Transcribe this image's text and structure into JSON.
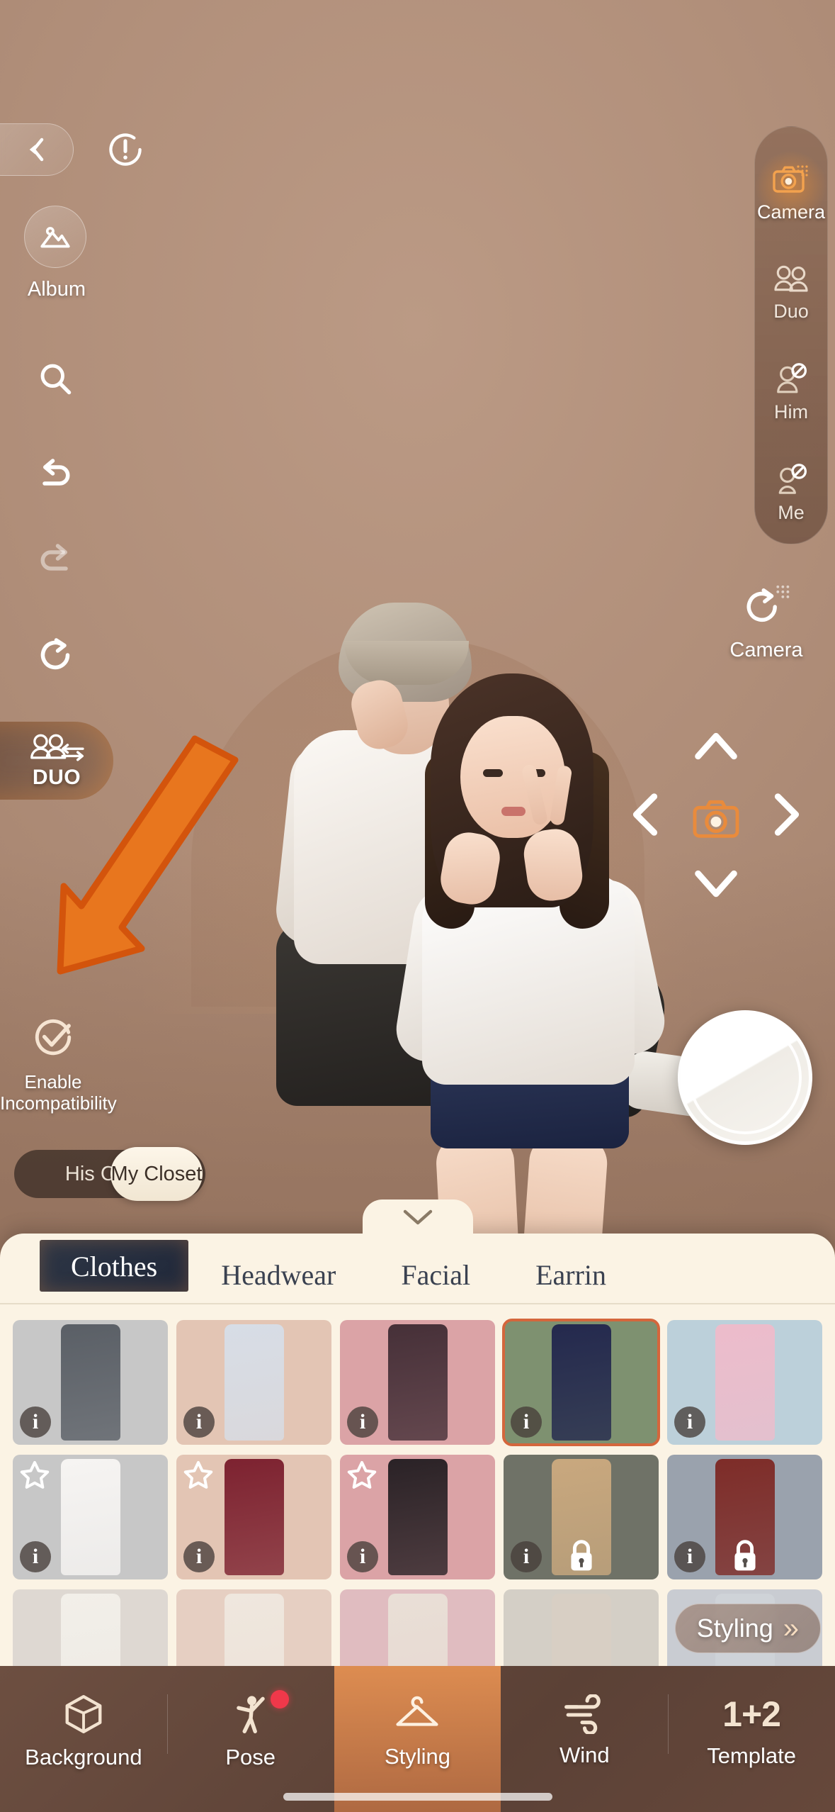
{
  "app": {
    "mode": "photo-studio"
  },
  "topbar": {
    "back_icon": "chevron-left-icon",
    "warning_icon": "exclamation-circle-icon"
  },
  "left_tools": {
    "album": {
      "label": "Album",
      "icon": "image-icon"
    },
    "search": {
      "icon": "search-icon"
    },
    "undo": {
      "icon": "undo-arrow-icon",
      "enabled": true
    },
    "redo": {
      "icon": "redo-arrow-icon",
      "enabled": false
    },
    "reset": {
      "icon": "rotate-reset-icon"
    },
    "duo": {
      "label": "DUO",
      "icon": "two-people-swap-icon",
      "active": true
    },
    "incompatibility": {
      "label_line1": "Enable",
      "label_line2": "Incompatibility",
      "icon": "check-circle-icon",
      "checked": true
    }
  },
  "closet_toggle": {
    "options": [
      "His Closet",
      "My Closet"
    ],
    "selected": "My Closet"
  },
  "mode_panel": {
    "items": [
      {
        "label": "Camera",
        "icon": "camera-icon",
        "active": true,
        "disabled": false
      },
      {
        "label": "Duo",
        "icon": "two-people-icon",
        "active": false,
        "disabled": false
      },
      {
        "label": "Him",
        "icon": "person-male-blocked-icon",
        "active": false,
        "disabled": true
      },
      {
        "label": "Me",
        "icon": "person-female-blocked-icon",
        "active": false,
        "disabled": true
      }
    ]
  },
  "camera_reset": {
    "label": "Camera",
    "icon": "rotate-reset-icon"
  },
  "dpad": {
    "up_icon": "chevron-up-icon",
    "down_icon": "chevron-down-icon",
    "left_icon": "chevron-left-icon",
    "right_icon": "chevron-right-icon",
    "center_icon": "camera-icon"
  },
  "shutter": {
    "icon": "shutter-button"
  },
  "sheet": {
    "collapse_icon": "chevron-down-icon",
    "tabs": [
      {
        "label": "Clothes",
        "active": true
      },
      {
        "label": "Headwear",
        "active": false
      },
      {
        "label": "Facial",
        "active": false
      },
      {
        "label": "Earrin",
        "active": false
      }
    ],
    "styling_button": {
      "label": "Styling",
      "chevrons": "»"
    },
    "items": [
      {
        "bg": "#c7c7c7",
        "garment": "#5a5f66",
        "badge": "info",
        "selected": false
      },
      {
        "bg": "#e3c5b4",
        "garment": "#d7dde6",
        "badge": "info",
        "selected": false
      },
      {
        "bg": "#dba3a6",
        "garment": "#463038",
        "badge": "info",
        "selected": false
      },
      {
        "bg": "#7e9170",
        "garment": "#24294e",
        "badge": "info",
        "selected": true
      },
      {
        "bg": "#bcd0da",
        "garment": "#edbccb",
        "badge": "info",
        "selected": false
      },
      {
        "bg": "#c7c7c7",
        "garment": "#f6f4f2",
        "badge": "star-info",
        "selected": false
      },
      {
        "bg": "#e3c5b4",
        "garment": "#7d2230",
        "badge": "star-info",
        "selected": false
      },
      {
        "bg": "#dba3a6",
        "garment": "#2a2226",
        "badge": "star-info",
        "selected": false
      },
      {
        "bg": "#6f7267",
        "garment": "#c9a87e",
        "badge": "lock-info",
        "selected": false
      },
      {
        "bg": "#9aa2ad",
        "garment": "#7e2c28",
        "badge": "lock-info",
        "selected": false
      },
      {
        "bg": "#ded8d2",
        "garment": "#f2efe9",
        "badge": "none",
        "selected": false
      },
      {
        "bg": "#e6cfc2",
        "garment": "#efe7de",
        "badge": "none",
        "selected": false
      },
      {
        "bg": "#e0bcc0",
        "garment": "#e9dfd6",
        "badge": "none",
        "selected": false
      },
      {
        "bg": "#d4cfc6",
        "garment": "#d8cfc4",
        "badge": "none",
        "selected": false
      },
      {
        "bg": "#c9ccd2",
        "garment": "#cfd3d8",
        "badge": "none",
        "selected": false
      }
    ]
  },
  "bottom_nav": {
    "items": [
      {
        "label": "Background",
        "icon": "cube-icon",
        "active": false,
        "badge": false
      },
      {
        "label": "Pose",
        "icon": "pose-person-icon",
        "active": false,
        "badge": true
      },
      {
        "label": "Styling",
        "icon": "hanger-icon",
        "active": true,
        "badge": false
      },
      {
        "label": "Wind",
        "icon": "wind-icon",
        "active": false,
        "badge": false
      },
      {
        "label": "Template",
        "icon": "one-plus-two-icon",
        "active": false,
        "badge": false,
        "glyph": "1+2"
      }
    ]
  },
  "colors": {
    "accent_orange": "#ee9654",
    "annotation_orange": "#e8761e",
    "sheet_cream": "#fbf3e4",
    "tab_active_navy": "#2e3645",
    "selected_border": "#d4663c",
    "badge_red": "#f0384a"
  }
}
